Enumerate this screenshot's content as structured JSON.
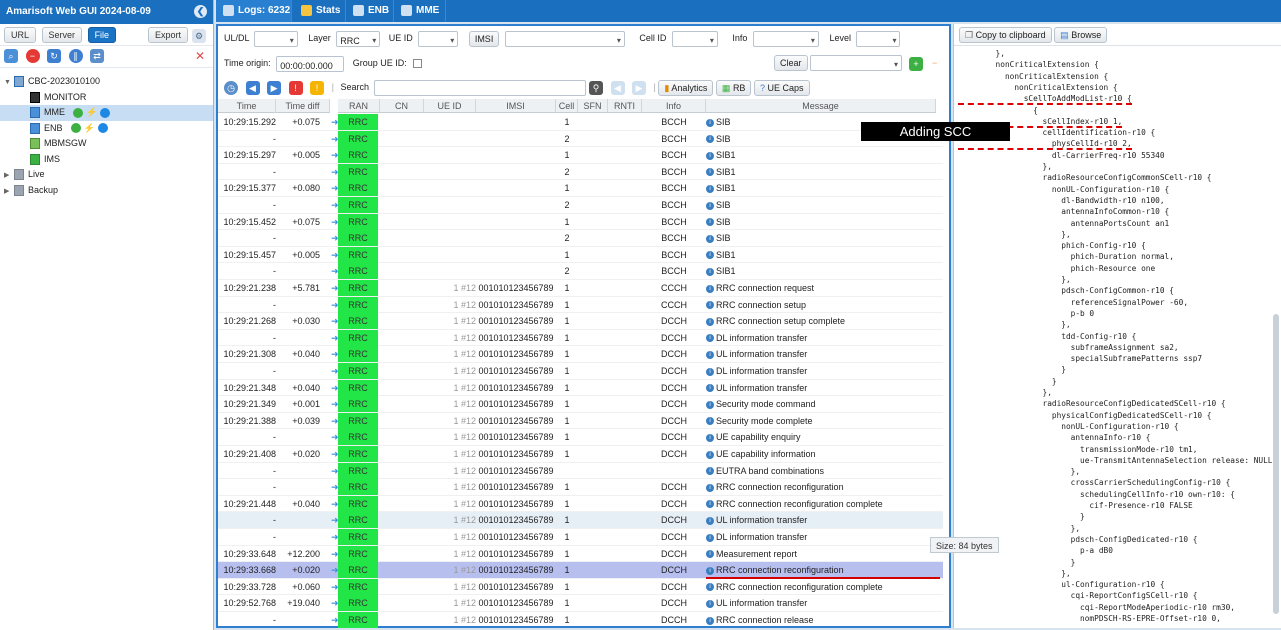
{
  "app": {
    "title": "Amarisoft Web GUI 2024-08-09"
  },
  "left": {
    "buttons": [
      "URL",
      "Server",
      "File"
    ],
    "export": "Export",
    "tree": [
      {
        "label": "CBC-2023010100",
        "level": 0
      },
      {
        "label": "MONITOR",
        "level": 1
      },
      {
        "label": "MME",
        "level": 1
      },
      {
        "label": "ENB",
        "level": 1
      },
      {
        "label": "MBMSGW",
        "level": 1
      },
      {
        "label": "IMS",
        "level": 1
      },
      {
        "label": "Live",
        "level": 0
      },
      {
        "label": "Backup",
        "level": 0
      }
    ]
  },
  "tabs": [
    "Logs: 6232",
    "Stats",
    "ENB",
    "MME"
  ],
  "filters": {
    "uldl_label": "UL/DL",
    "layer_label": "Layer",
    "layer_value": "RRC",
    "ueid_label": "UE ID",
    "imsi_btn": "IMSI",
    "cellid_label": "Cell ID",
    "info_label": "Info",
    "level_label": "Level",
    "time_origin_label": "Time origin:",
    "time_origin_value": "00:00:00.000",
    "group_ue_label": "Group UE ID:",
    "clear": "Clear",
    "search_label": "Search",
    "analytics": "Analytics",
    "rb": "RB",
    "uecaps": "UE Caps"
  },
  "columns": [
    "Time",
    "Time diff",
    "RAN",
    "CN",
    "UE ID",
    "IMSI",
    "Cell",
    "SFN",
    "RNTI",
    "Info",
    "Message"
  ],
  "rows": [
    [
      "10:29:15.292",
      "+0.075",
      "RRC",
      "",
      "",
      "",
      "1",
      "",
      "",
      "BCCH",
      "SIB"
    ],
    [
      "-",
      "",
      "RRC",
      "",
      "",
      "",
      "2",
      "",
      "",
      "BCCH",
      "SIB"
    ],
    [
      "10:29:15.297",
      "+0.005",
      "RRC",
      "",
      "",
      "",
      "1",
      "",
      "",
      "BCCH",
      "SIB1"
    ],
    [
      "-",
      "",
      "RRC",
      "",
      "",
      "",
      "2",
      "",
      "",
      "BCCH",
      "SIB1"
    ],
    [
      "10:29:15.377",
      "+0.080",
      "RRC",
      "",
      "",
      "",
      "1",
      "",
      "",
      "BCCH",
      "SIB1"
    ],
    [
      "-",
      "",
      "RRC",
      "",
      "",
      "",
      "2",
      "",
      "",
      "BCCH",
      "SIB"
    ],
    [
      "10:29:15.452",
      "+0.075",
      "RRC",
      "",
      "",
      "",
      "1",
      "",
      "",
      "BCCH",
      "SIB"
    ],
    [
      "-",
      "",
      "RRC",
      "",
      "",
      "",
      "2",
      "",
      "",
      "BCCH",
      "SIB"
    ],
    [
      "10:29:15.457",
      "+0.005",
      "RRC",
      "",
      "",
      "",
      "1",
      "",
      "",
      "BCCH",
      "SIB1"
    ],
    [
      "-",
      "",
      "RRC",
      "",
      "",
      "",
      "2",
      "",
      "",
      "BCCH",
      "SIB1"
    ],
    [
      "10:29:21.238",
      "+5.781",
      "RRC",
      "",
      "1 #12",
      "001010123456789",
      "1",
      "",
      "",
      "CCCH",
      "RRC connection request"
    ],
    [
      "-",
      "",
      "RRC",
      "",
      "1 #12",
      "001010123456789",
      "1",
      "",
      "",
      "CCCH",
      "RRC connection setup"
    ],
    [
      "10:29:21.268",
      "+0.030",
      "RRC",
      "",
      "1 #12",
      "001010123456789",
      "1",
      "",
      "",
      "DCCH",
      "RRC connection setup complete"
    ],
    [
      "-",
      "",
      "RRC",
      "",
      "1 #12",
      "001010123456789",
      "1",
      "",
      "",
      "DCCH",
      "DL information transfer"
    ],
    [
      "10:29:21.308",
      "+0.040",
      "RRC",
      "",
      "1 #12",
      "001010123456789",
      "1",
      "",
      "",
      "DCCH",
      "UL information transfer"
    ],
    [
      "-",
      "",
      "RRC",
      "",
      "1 #12",
      "001010123456789",
      "1",
      "",
      "",
      "DCCH",
      "DL information transfer"
    ],
    [
      "10:29:21.348",
      "+0.040",
      "RRC",
      "",
      "1 #12",
      "001010123456789",
      "1",
      "",
      "",
      "DCCH",
      "UL information transfer"
    ],
    [
      "10:29:21.349",
      "+0.001",
      "RRC",
      "",
      "1 #12",
      "001010123456789",
      "1",
      "",
      "",
      "DCCH",
      "Security mode command"
    ],
    [
      "10:29:21.388",
      "+0.039",
      "RRC",
      "",
      "1 #12",
      "001010123456789",
      "1",
      "",
      "",
      "DCCH",
      "Security mode complete"
    ],
    [
      "-",
      "",
      "RRC",
      "",
      "1 #12",
      "001010123456789",
      "1",
      "",
      "",
      "DCCH",
      "UE capability enquiry"
    ],
    [
      "10:29:21.408",
      "+0.020",
      "RRC",
      "",
      "1 #12",
      "001010123456789",
      "1",
      "",
      "",
      "DCCH",
      "UE capability information"
    ],
    [
      "-",
      "",
      "RRC",
      "",
      "1 #12",
      "001010123456789",
      "",
      "",
      "",
      "",
      "EUTRA band combinations"
    ],
    [
      "-",
      "",
      "RRC",
      "",
      "1 #12",
      "001010123456789",
      "1",
      "",
      "",
      "DCCH",
      "RRC connection reconfiguration"
    ],
    [
      "10:29:21.448",
      "+0.040",
      "RRC",
      "",
      "1 #12",
      "001010123456789",
      "1",
      "",
      "",
      "DCCH",
      "RRC connection reconfiguration complete"
    ],
    [
      "-",
      "",
      "RRC",
      "",
      "1 #12",
      "001010123456789",
      "1",
      "",
      "",
      "DCCH",
      "UL information transfer"
    ],
    [
      "-",
      "",
      "RRC",
      "",
      "1 #12",
      "001010123456789",
      "1",
      "",
      "",
      "DCCH",
      "DL information transfer"
    ],
    [
      "10:29:33.648",
      "+12.200",
      "RRC",
      "",
      "1 #12",
      "001010123456789",
      "1",
      "",
      "",
      "DCCH",
      "Measurement report"
    ],
    [
      "10:29:33.668",
      "+0.020",
      "RRC",
      "",
      "1 #12",
      "001010123456789",
      "1",
      "",
      "",
      "DCCH",
      "RRC connection reconfiguration"
    ],
    [
      "10:29:33.728",
      "+0.060",
      "RRC",
      "",
      "1 #12",
      "001010123456789",
      "1",
      "",
      "",
      "DCCH",
      "RRC connection reconfiguration complete"
    ],
    [
      "10:29:52.768",
      "+19.040",
      "RRC",
      "",
      "1 #12",
      "001010123456789",
      "1",
      "",
      "",
      "DCCH",
      "UL information transfer"
    ],
    [
      "-",
      "",
      "RRC",
      "",
      "1 #12",
      "001010123456789",
      "1",
      "",
      "",
      "DCCH",
      "RRC connection release"
    ]
  ],
  "right": {
    "copy": "Copy to clipboard",
    "browse": "Browse",
    "code": [
      "        },",
      "        nonCriticalExtension {",
      "          nonCriticalExtension {",
      "            nonCriticalExtension {",
      "              sCellToAddModList-r10 {",
      "                {",
      "                  sCellIndex-r10 1,",
      "                  cellIdentification-r10 {",
      "                    physCellId-r10 2,",
      "                    dl-CarrierFreq-r10 55340",
      "                  },",
      "                  radioResourceConfigCommonSCell-r10 {",
      "                    nonUL-Configuration-r10 {",
      "                      dl-Bandwidth-r10 n100,",
      "                      antennaInfoCommon-r10 {",
      "                        antennaPortsCount an1",
      "                      },",
      "                      phich-Config-r10 {",
      "                        phich-Duration normal,",
      "                        phich-Resource one",
      "                      },",
      "                      pdsch-ConfigCommon-r10 {",
      "                        referenceSignalPower -60,",
      "                        p-b 0",
      "                      },",
      "                      tdd-Config-r10 {",
      "                        subframeAssignment sa2,",
      "                        specialSubframePatterns ssp7",
      "                      }",
      "                    }",
      "                  },",
      "                  radioResourceConfigDedicatedSCell-r10 {",
      "                    physicalConfigDedicatedSCell-r10 {",
      "                      nonUL-Configuration-r10 {",
      "                        antennaInfo-r10 {",
      "                          transmissionMode-r10 tm1,",
      "                          ue-TransmitAntennaSelection release: NULL",
      "                        },",
      "                        crossCarrierSchedulingConfig-r10 {",
      "                          schedulingCellInfo-r10 own-r10: {",
      "                            cif-Presence-r10 FALSE",
      "                          }",
      "                        },",
      "                        pdsch-ConfigDedicated-r10 {",
      "                          p-a dB0",
      "                        }",
      "                      },",
      "                      ul-Configuration-r10 {",
      "                        cqi-ReportConfigSCell-r10 {",
      "                          cqi-ReportModeAperiodic-r10 rm30,",
      "                          nomPDSCH-RS-EPRE-Offset-r10 0,"
    ]
  },
  "annotation": "Adding SCC",
  "tooltip": "Size: 84 bytes"
}
